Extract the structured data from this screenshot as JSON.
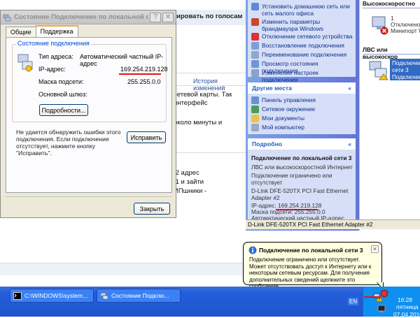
{
  "webpage": {
    "header_link": "ировать по голосам",
    "history_link": "История изменений",
    "text_lines": [
      "сетевой карты. Так",
      "интерфейс",
      "около минуты и",
      "",
      ",2 адрес",
      ",1 и зайти",
      "ИПшники -"
    ],
    "fragments": [
      "й",
      "б",
      "е",
      "э",
      "п",
      "с",
      "ч"
    ]
  },
  "dialog": {
    "title": "Состояние Подключение по локальной сети 3",
    "tabs": [
      "Общие",
      "Поддержка"
    ],
    "group_title": "Состояние подключения",
    "address_type_label": "Тип адреса:",
    "address_type_value": "Автоматический частный IP-адрес",
    "ip_label": "IP-адрес:",
    "ip_value": "169.254.219.128",
    "mask_label": "Маска подсети:",
    "mask_value": "255.255.0.0",
    "gateway_label": "Основной шлюз:",
    "gateway_value": "",
    "details_button": "Подробности...",
    "message": "Не удается обнаружить ошибки этого подключения. Если подключение отсутствует, нажмите кнопку \"Исправить\".",
    "repair_button": "Исправить",
    "close_button": "Закрыть"
  },
  "taskpane": {
    "network_tasks": [
      {
        "label": "Установить домашнюю сеть или сеть малого офиса",
        "icon": "home-network-icon"
      },
      {
        "label": "Изменить параметры брандмауэра Windows",
        "icon": "firewall-icon"
      },
      {
        "label": "Отключение сетевого устройства",
        "icon": "disable-device-icon"
      },
      {
        "label": "Восстановление подключения",
        "icon": "repair-icon"
      },
      {
        "label": "Переименование подключения",
        "icon": "rename-icon"
      },
      {
        "label": "Просмотр состояния подключения",
        "icon": "status-icon"
      },
      {
        "label": "Изменение настроек подключения",
        "icon": "settings-icon"
      }
    ],
    "other_places_title": "Другие места",
    "other_places": [
      {
        "label": "Панель управления",
        "icon": "control-panel-icon"
      },
      {
        "label": "Сетевое окружение",
        "icon": "network-places-icon"
      },
      {
        "label": "Мои документы",
        "icon": "my-documents-icon"
      },
      {
        "label": "Мой компьютер",
        "icon": "my-computer-icon"
      }
    ],
    "details_title": "Подробно",
    "details_name": "Подключение по локальной сети 3",
    "details_lines": [
      "ЛВС или высокоскоростной Интернет",
      "Подключение ограничено или",
      "отсутствует",
      "D-Link DFE-520TX PCI Fast Ethernet",
      "Adapter #2",
      "IP-адрес: 169.254.219.128",
      "Маска подсети: 255.255.0.0",
      "Автоматический частный IP-адрес"
    ]
  },
  "rightpane": {
    "section1": "Высокоскоростно",
    "conn1_lines": [
      "1",
      "Отключено",
      "Миниnорт W"
    ],
    "section2": "ЛВС или высокоскор",
    "conn2_lines": [
      "Подключение",
      "сети 3",
      "Подключено"
    ]
  },
  "explorer_status": "D-Link DFE-520TX PCI Fast Ethernet Adapter #2",
  "balloon": {
    "title": "Подключение по локальной сети 3",
    "text": "Подключение ограничено или отсутствует. Может отсутствовать доступ к Интернету или к некоторым сетевым ресурсам. Для получения дополнительных сведений щелкните это сообщение."
  },
  "taskbar": {
    "tasks": [
      "C:\\WINDOWS\\system...",
      "Состояние Подклю..."
    ],
    "language": "EN",
    "time": "16:28",
    "day": "пятница",
    "date": "07.04.2010"
  },
  "colors": {
    "accent_red": "#e0141a",
    "xp_blue": "#245edb",
    "link_blue": "#0c2f8a"
  }
}
